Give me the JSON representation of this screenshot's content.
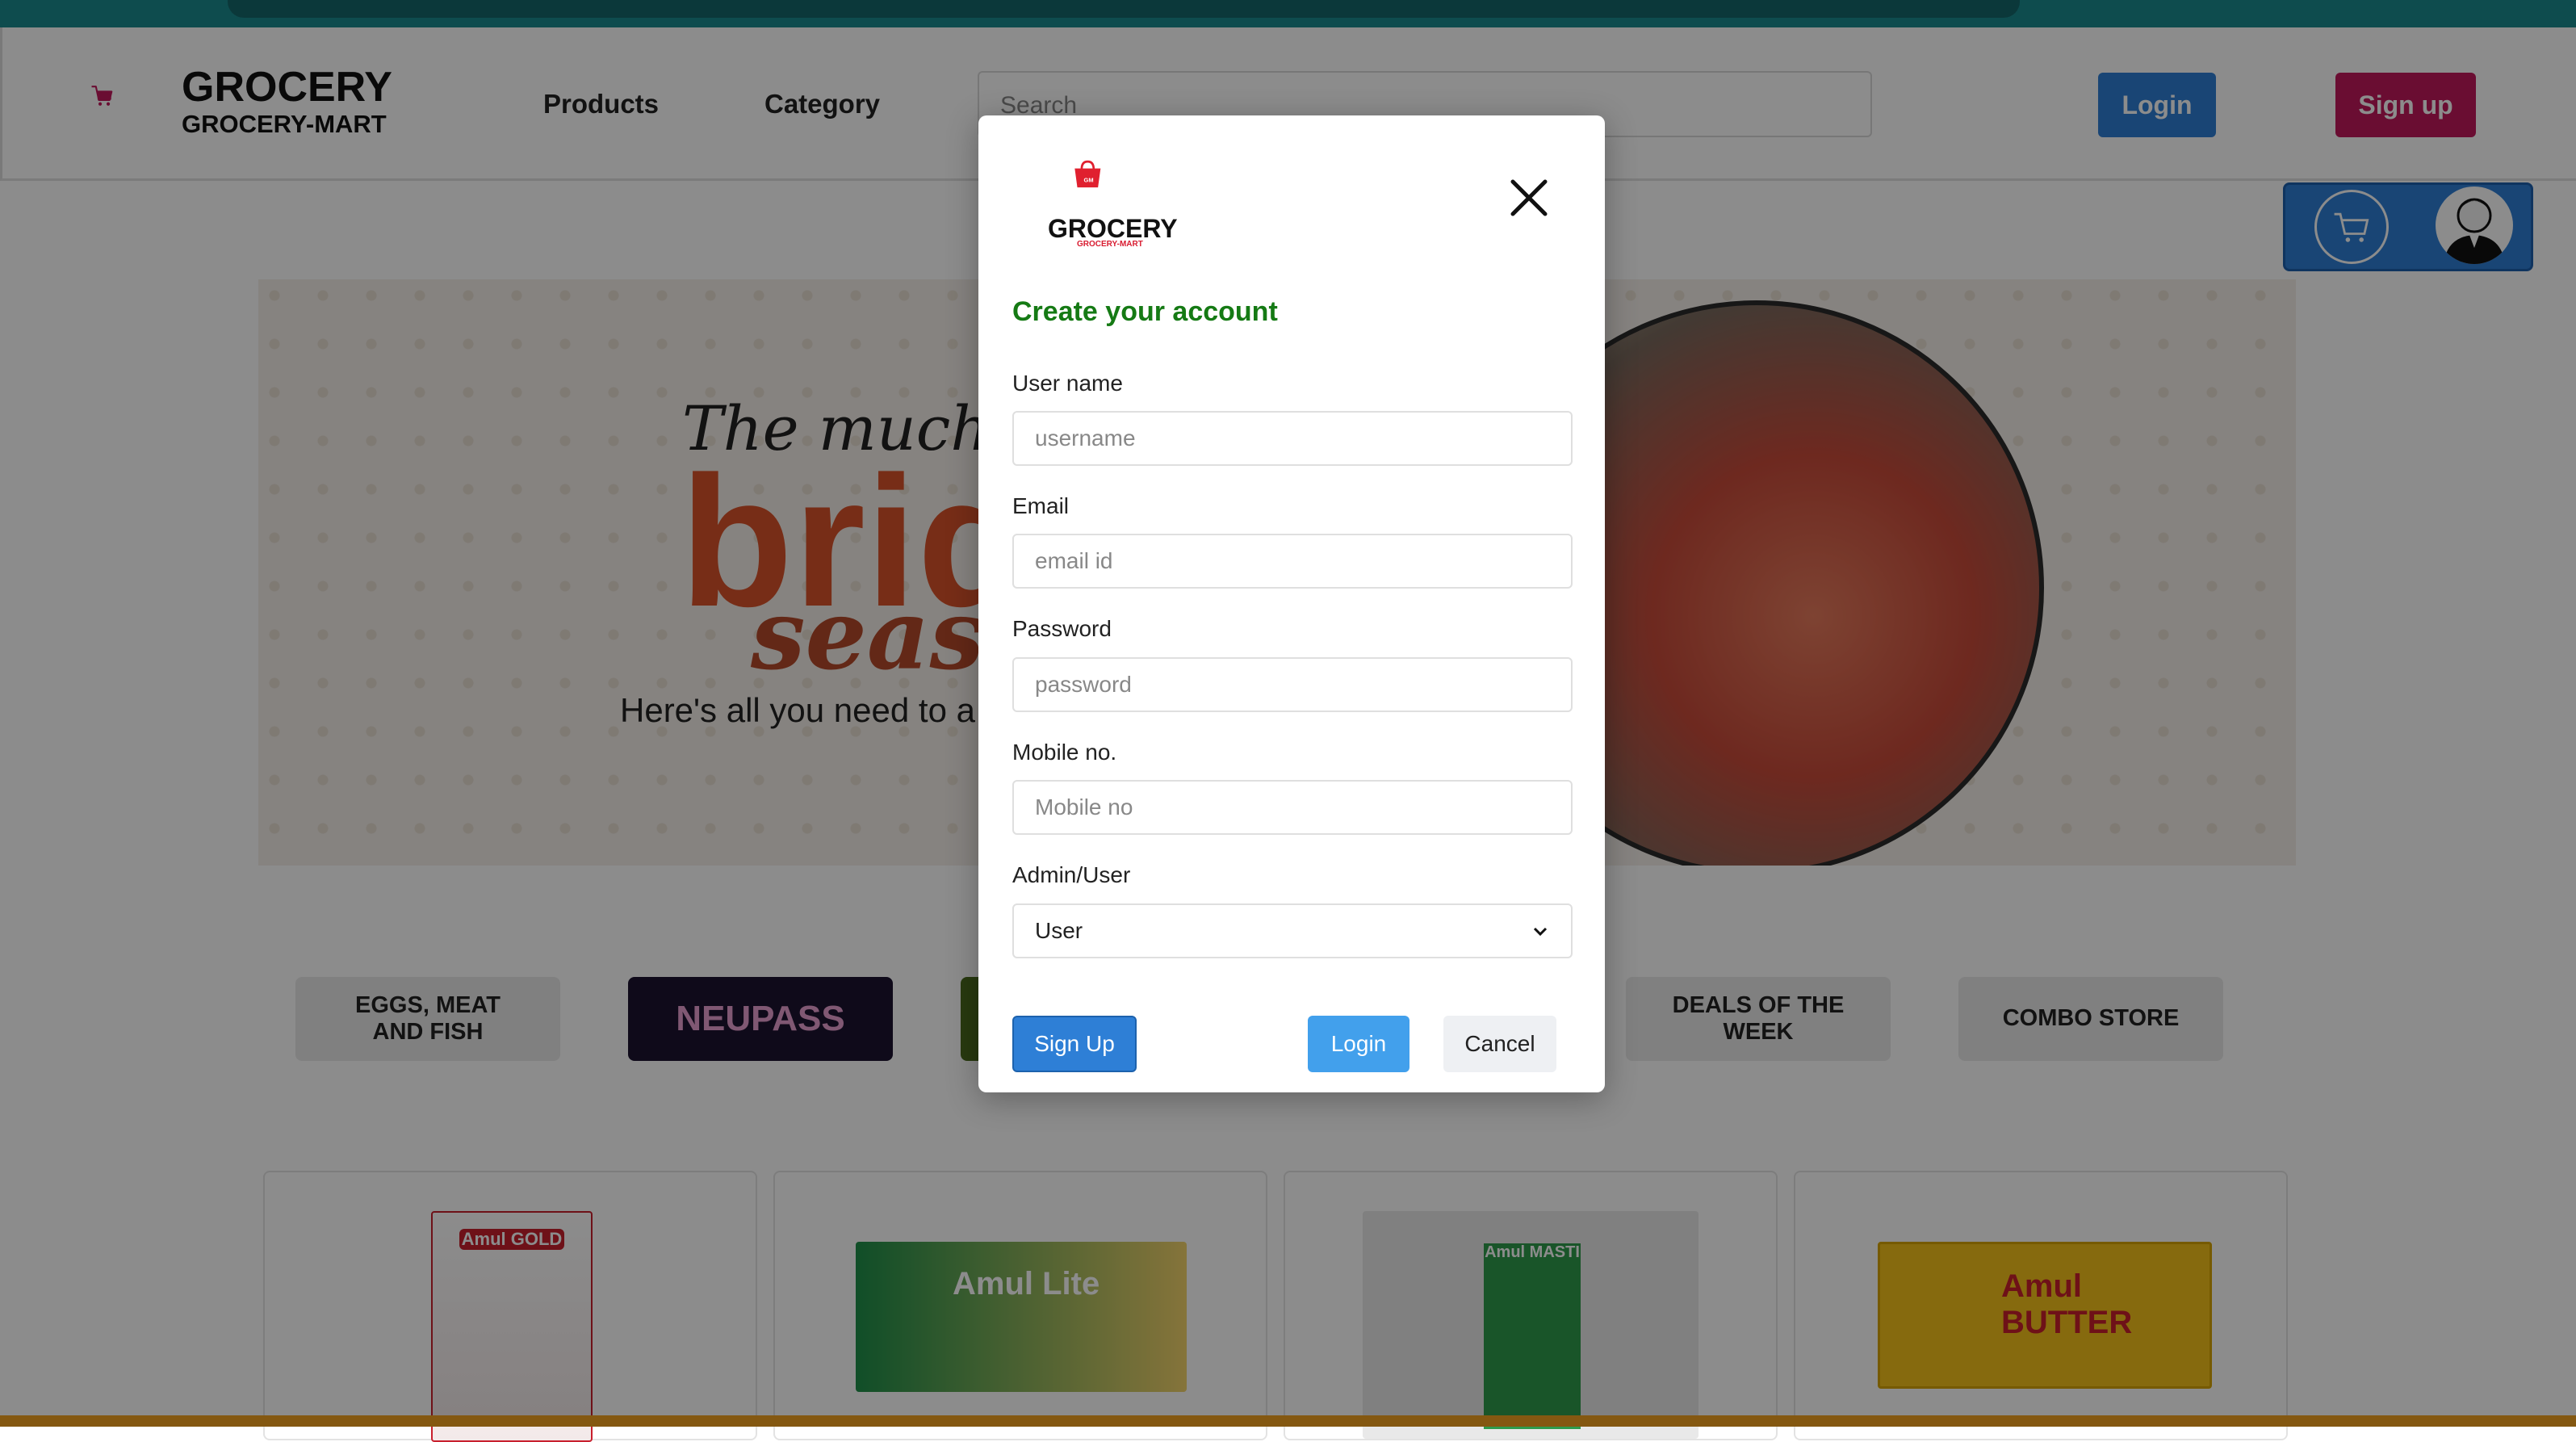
{
  "header": {
    "logo_title": "GROCERY",
    "logo_subtitle": "GROCERY-MART",
    "nav": [
      "Products",
      "Category"
    ],
    "search_placeholder": "Search",
    "login_label": "Login",
    "signup_label": "Sign up"
  },
  "banner": {
    "script_text": "The much-awaited",
    "big_text": "bridal",
    "season_text": "season",
    "subtitle": "Here's all you need to a"
  },
  "categories": [
    "EGGS, MEAT AND FISH",
    "NEUPASS",
    "",
    "",
    "DEALS OF THE WEEK",
    "COMBO STORE"
  ],
  "products": [
    "Amul GOLD",
    "Amul Lite",
    "Amul MASTI",
    "Amul BUTTER"
  ],
  "modal": {
    "logo_title": "GROCERY",
    "logo_badge": "GM",
    "logo_subtitle": "GROCERY-MART",
    "title": "Create your account",
    "fields": [
      {
        "label": "User name",
        "placeholder": "username"
      },
      {
        "label": "Email",
        "placeholder": "email id"
      },
      {
        "label": "Password",
        "placeholder": "password"
      },
      {
        "label": "Mobile no.",
        "placeholder": "Mobile no"
      }
    ],
    "role_label": "Admin/User",
    "role_value": "User",
    "signup_button": "Sign Up",
    "login_button": "Login",
    "cancel_button": "Cancel"
  },
  "colors": {
    "accent_blue": "#2e7fd6",
    "brand_pink": "#c2185b",
    "title_green": "#157a14",
    "logo_red": "#d81b30"
  }
}
